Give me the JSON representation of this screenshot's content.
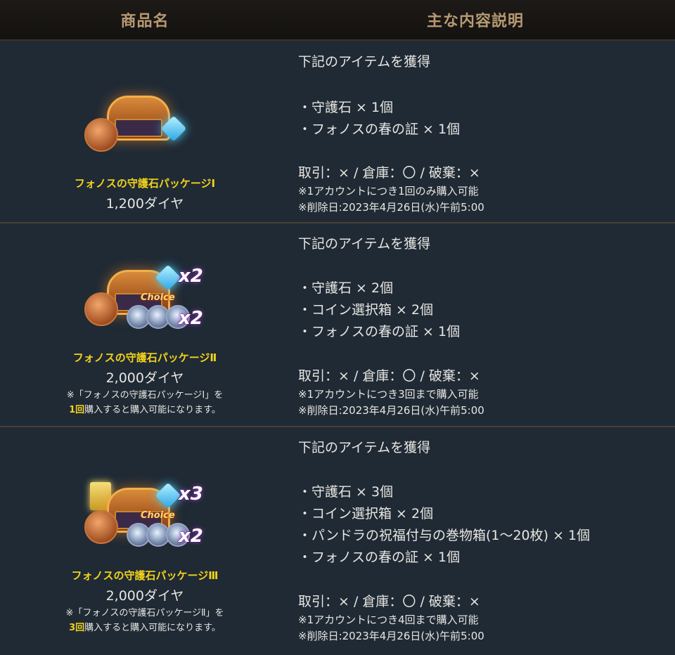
{
  "header": {
    "col_name": "商品名",
    "col_desc": "主な内容説明"
  },
  "rows": [
    {
      "name": "フォノスの守護石パッケージⅠ",
      "price": "1,200ダイヤ",
      "note_line1": "",
      "note_count": "",
      "note_line2_rest": "",
      "art": {
        "crystal_mult": "",
        "orb_mult": "",
        "choice": ""
      },
      "intro": "下記のアイテムを獲得",
      "items": [
        "・守護石 × 1個",
        "・フォノスの春の証 × 1個"
      ],
      "trade": "取引：× / 倉庫：〇 / 破棄：×",
      "limit": "※1アカウントにつき1回のみ購入可能",
      "delete": "※削除日:2023年4月26日(水)午前5:00"
    },
    {
      "name": "フォノスの守護石パッケージⅡ",
      "price": "2,000ダイヤ",
      "note_line1": "※「フォノスの守護石パッケージⅠ」を",
      "note_count": "1回",
      "note_line2_rest": "購入すると購入可能になります。",
      "art": {
        "crystal_mult": "x2",
        "orb_mult": "x2",
        "choice": "Choice"
      },
      "intro": "下記のアイテムを獲得",
      "items": [
        "・守護石 × 2個",
        "・コイン選択箱 × 2個",
        "・フォノスの春の証 × 1個"
      ],
      "trade": "取引：× / 倉庫：〇 / 破棄：×",
      "limit": "※1アカウントにつき3回まで購入可能",
      "delete": "※削除日:2023年4月26日(水)午前5:00"
    },
    {
      "name": "フォノスの守護石パッケージⅢ",
      "price": "2,000ダイヤ",
      "note_line1": "※「フォノスの守護石パッケージⅡ」を",
      "note_count": "3回",
      "note_line2_rest": "購入すると購入可能になります。",
      "art": {
        "crystal_mult": "x3",
        "orb_mult": "x2",
        "choice": "Choice"
      },
      "intro": "下記のアイテムを獲得",
      "items": [
        "・守護石 × 3個",
        "・コイン選択箱 × 2個",
        "・パンドラの祝福付与の巻物箱(1～20枚) × 1個",
        "・フォノスの春の証 × 1個"
      ],
      "trade": "取引：× / 倉庫：〇 / 破棄：×",
      "limit": "※1アカウントにつき4回まで購入可能",
      "delete": "※削除日:2023年4月26日(水)午前5:00"
    }
  ]
}
